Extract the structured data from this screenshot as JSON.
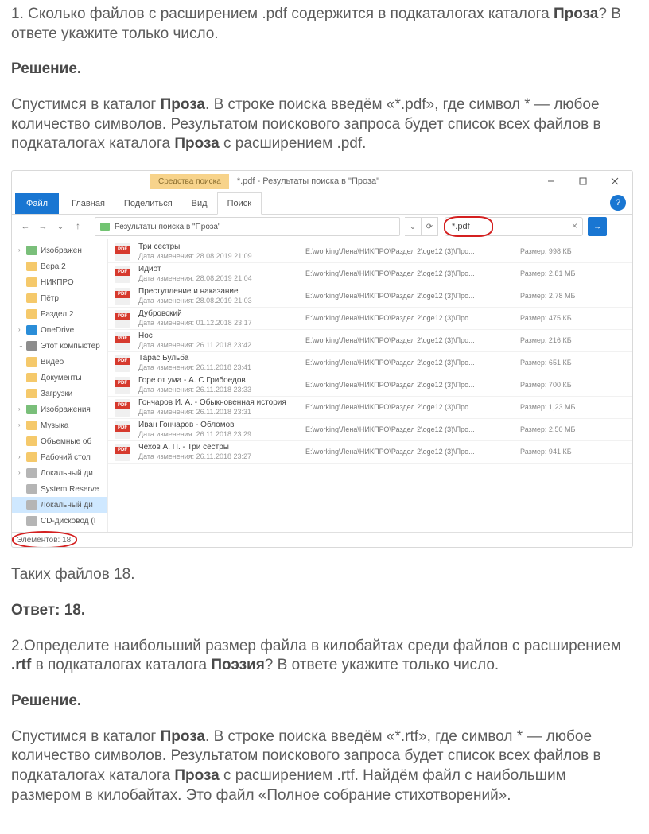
{
  "text": {
    "q1": "1. Сколько файлов с расширением .pdf содержится в подкаталогах каталога ",
    "q1b": "Проза",
    "q1c": "? В ответе укажите только число.",
    "solution": "Решение.",
    "sol1a": "Спустимся в каталог ",
    "sol1b": "Проза",
    "sol1c": ". В строке поиска введём «*.pdf», где символ *  — любое количество символов. Результатом поискового запроса будет список всех файлов в подкаталогах каталога ",
    "sol1d": "Проза",
    "sol1e": " с расширением .pdf.",
    "after1": "Таких файлов 18.",
    "ans1": "Ответ: 18.",
    "q2a": "2.Определите наибольший размер файла в килобайтах среди файлов с расширением ",
    "q2b": ".rtf",
    "q2c": " в подкаталогах каталога ",
    "q2d": "Поэзия",
    "q2e": "? В ответе укажите только число.",
    "sol2a": "Спустимся в каталог ",
    "sol2b": "Проза",
    "sol2c": ". В строке поиска введём «*.rtf», где символ *  — любое количество символов. Результатом поискового запроса будет список всех файлов в подкаталогах каталога ",
    "sol2d": "Проза",
    "sol2e": " с расширением .rtf. Найдём файл с наибольшим размером в килобайтах. Это файл «Полное собрание стихотворений»."
  },
  "explorer": {
    "tools_label": "Средства поиска",
    "title": "*.pdf - Результаты поиска в \"Проза\"",
    "ribbon": {
      "file": "Файл",
      "tabs": [
        "Главная",
        "Поделиться",
        "Вид",
        "Поиск"
      ]
    },
    "breadcrumb": "Результаты поиска в \"Проза\"",
    "search_value": "*.pdf",
    "sidebar": [
      {
        "label": "Изображен",
        "type": "pic",
        "chev": "›"
      },
      {
        "label": "Вера 2",
        "type": "fld"
      },
      {
        "label": "НИКПРО",
        "type": "fld"
      },
      {
        "label": "Пётр",
        "type": "fld"
      },
      {
        "label": "Раздел 2",
        "type": "fld"
      },
      {
        "label": "OneDrive",
        "type": "od",
        "chev": "›"
      },
      {
        "label": "Этот компьютер",
        "type": "pc",
        "chev": "⌄"
      },
      {
        "label": "Видео",
        "type": "fld"
      },
      {
        "label": "Документы",
        "type": "fld"
      },
      {
        "label": "Загрузки",
        "type": "fld"
      },
      {
        "label": "Изображения",
        "type": "pic",
        "chev": "›"
      },
      {
        "label": "Музыка",
        "type": "fld",
        "chev": "›"
      },
      {
        "label": "Объемные об",
        "type": "fld"
      },
      {
        "label": "Рабочий стол",
        "type": "fld",
        "chev": "›"
      },
      {
        "label": "Локальный ди",
        "type": "drv",
        "chev": "›"
      },
      {
        "label": "System Reserve",
        "type": "drv"
      },
      {
        "label": "Локальный ди",
        "type": "drv",
        "sel": true
      },
      {
        "label": "CD-дисковод (I",
        "type": "drv"
      }
    ],
    "files": [
      {
        "name": "Три сестры",
        "date": "Дата изменения: 28.08.2019 21:09",
        "path": "E:\\working\\Лена\\НИКПРО\\Раздел 2\\oge12 (3)\\Про...",
        "size": "Размер: 998 КБ"
      },
      {
        "name": "Идиот",
        "date": "Дата изменения: 28.08.2019 21:04",
        "path": "E:\\working\\Лена\\НИКПРО\\Раздел 2\\oge12 (3)\\Про...",
        "size": "Размер: 2,81 МБ"
      },
      {
        "name": "Преступление и наказание",
        "date": "Дата изменения: 28.08.2019 21:03",
        "path": "E:\\working\\Лена\\НИКПРО\\Раздел 2\\oge12 (3)\\Про...",
        "size": "Размер: 2,78 МБ"
      },
      {
        "name": "Дубровский",
        "date": "Дата изменения: 01.12.2018 23:17",
        "path": "E:\\working\\Лена\\НИКПРО\\Раздел 2\\oge12 (3)\\Про...",
        "size": "Размер: 475 КБ"
      },
      {
        "name": "Нос",
        "date": "Дата изменения: 26.11.2018 23:42",
        "path": "E:\\working\\Лена\\НИКПРО\\Раздел 2\\oge12 (3)\\Про...",
        "size": "Размер: 216 КБ"
      },
      {
        "name": "Тарас Бульба",
        "date": "Дата изменения: 26.11.2018 23:41",
        "path": "E:\\working\\Лена\\НИКПРО\\Раздел 2\\oge12 (3)\\Про...",
        "size": "Размер: 651 КБ"
      },
      {
        "name": "Горе от ума - А. С Грибоедов",
        "date": "Дата изменения: 26.11.2018 23:33",
        "path": "E:\\working\\Лена\\НИКПРО\\Раздел 2\\oge12 (3)\\Про...",
        "size": "Размер: 700 КБ"
      },
      {
        "name": "Гончаров И. А. - Обыкновенная история",
        "date": "Дата изменения: 26.11.2018 23:31",
        "path": "E:\\working\\Лена\\НИКПРО\\Раздел 2\\oge12 (3)\\Про...",
        "size": "Размер: 1,23 МБ"
      },
      {
        "name": "Иван Гончаров - Обломов",
        "date": "Дата изменения: 26.11.2018 23:29",
        "path": "E:\\working\\Лена\\НИКПРО\\Раздел 2\\oge12 (3)\\Про...",
        "size": "Размер: 2,50 МБ"
      },
      {
        "name": "Чехов А. П. - Три сестры",
        "date": "Дата изменения: 26.11.2018 23:27",
        "path": "E:\\working\\Лена\\НИКПРО\\Раздел 2\\oge12 (3)\\Про...",
        "size": "Размер: 941 КБ"
      }
    ],
    "status": "Элементов: 18"
  }
}
